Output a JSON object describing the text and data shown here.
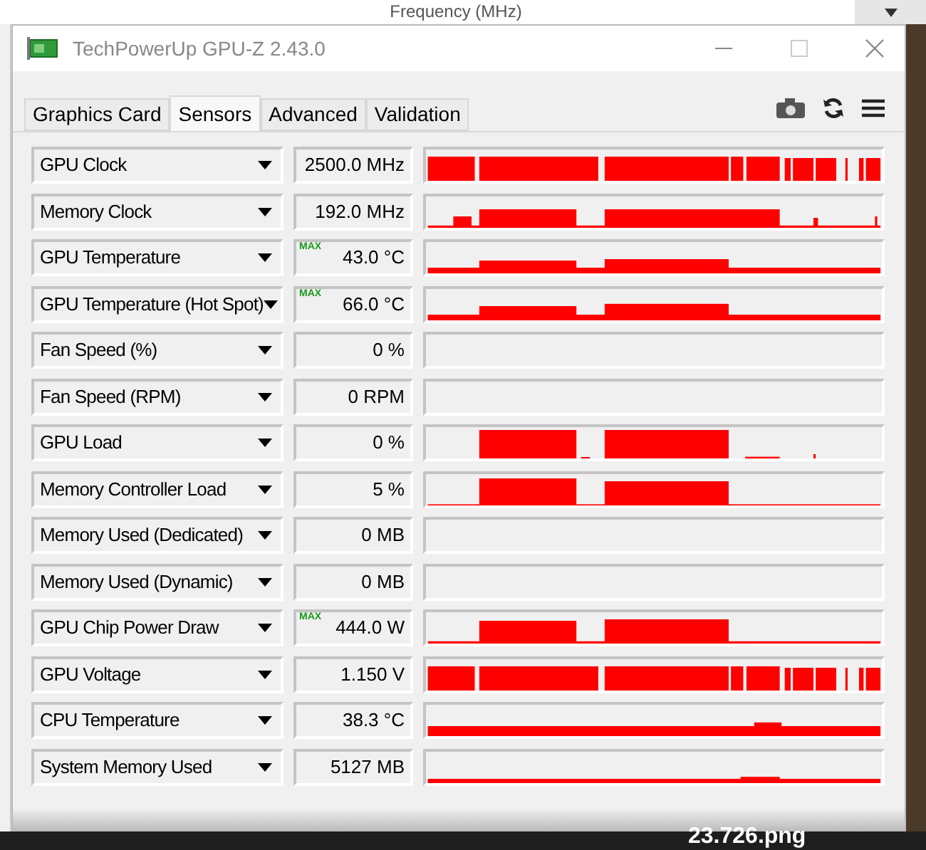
{
  "background_window": {
    "heading": "Frequency (MHz)"
  },
  "window": {
    "title": "TechPowerUp GPU-Z 2.43.0"
  },
  "tabs": [
    {
      "label": "Graphics Card",
      "selected": false
    },
    {
      "label": "Sensors",
      "selected": true
    },
    {
      "label": "Advanced",
      "selected": false
    },
    {
      "label": "Validation",
      "selected": false
    }
  ],
  "sensors": [
    {
      "name": "GPU Clock",
      "value": "2500.0 MHz"
    },
    {
      "name": "Memory Clock",
      "value": "192.0 MHz"
    },
    {
      "name": "GPU Temperature",
      "badge": "MAX",
      "value": "43.0 °C"
    },
    {
      "name": "GPU Temperature (Hot Spot)",
      "badge": "MAX",
      "value": "66.0 °C"
    },
    {
      "name": "Fan Speed (%)",
      "value": "0 %"
    },
    {
      "name": "Fan Speed (RPM)",
      "value": "0 RPM"
    },
    {
      "name": "GPU Load",
      "value": "0 %"
    },
    {
      "name": "Memory Controller Load",
      "value": "5 %"
    },
    {
      "name": "Memory Used (Dedicated)",
      "value": "0 MB"
    },
    {
      "name": "Memory Used (Dynamic)",
      "value": "0 MB"
    },
    {
      "name": "GPU Chip Power Draw",
      "badge": "MAX",
      "value": "444.0 W"
    },
    {
      "name": "GPU Voltage",
      "value": "1.150 V"
    },
    {
      "name": "CPU Temperature",
      "value": "38.3 °C"
    },
    {
      "name": "System Memory Used",
      "value": "5127 MB"
    }
  ],
  "caption": "23.726.png"
}
